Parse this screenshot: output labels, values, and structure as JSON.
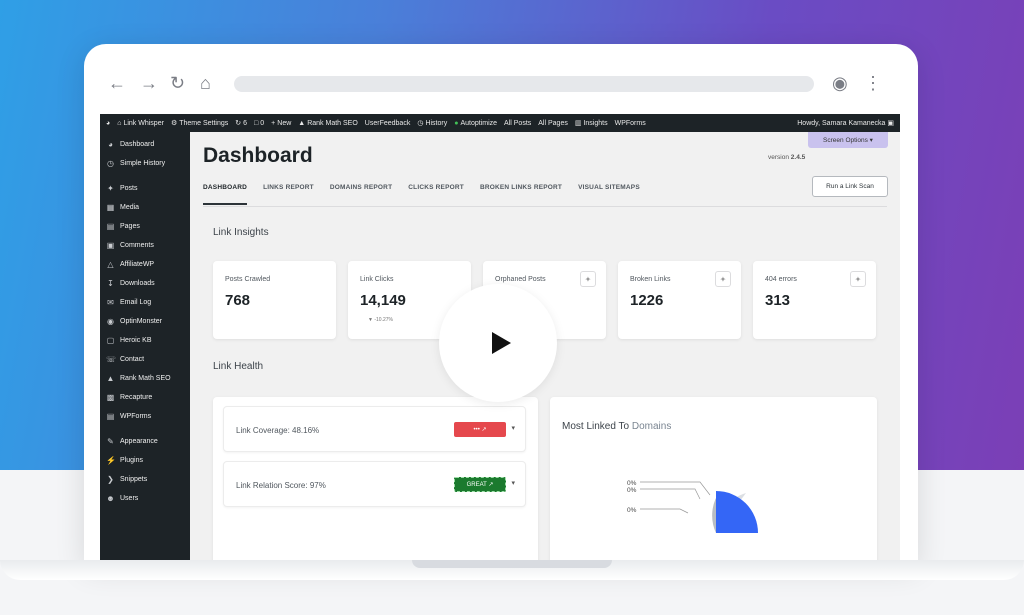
{
  "colors": {
    "gradient_start": "#2f9fe6",
    "gradient_end": "#7b3fb6",
    "wp_dark": "#1d2327",
    "badge_red": "#e5484d",
    "badge_green": "#1b7a2e",
    "chart_blue": "#3466f6"
  },
  "browser": {
    "icons": [
      "back-arrow-icon",
      "forward-arrow-icon",
      "reload-icon",
      "home-icon",
      "extension-icon",
      "kebab-menu-icon"
    ]
  },
  "topbar": {
    "items": [
      "Link Whisper",
      "Theme Settings",
      "6",
      "0",
      "New",
      "Rank Math SEO",
      "UserFeedback",
      "History",
      "Autoptimize",
      "All Posts",
      "All Pages",
      "Insights",
      "WPForms"
    ],
    "howdy": "Howdy, Samara Kamanecka"
  },
  "sidebar": {
    "items": [
      {
        "label": "Dashboard",
        "icon": "gauge-icon"
      },
      {
        "label": "Simple History",
        "icon": "history-icon"
      },
      {
        "label": "Posts",
        "icon": "pin-icon"
      },
      {
        "label": "Media",
        "icon": "media-icon"
      },
      {
        "label": "Pages",
        "icon": "page-icon"
      },
      {
        "label": "Comments",
        "icon": "comment-icon"
      },
      {
        "label": "AffiliateWP",
        "icon": "affiliate-icon"
      },
      {
        "label": "Downloads",
        "icon": "download-icon"
      },
      {
        "label": "Email Log",
        "icon": "email-icon"
      },
      {
        "label": "OptinMonster",
        "icon": "monster-icon"
      },
      {
        "label": "Heroic KB",
        "icon": "kb-icon"
      },
      {
        "label": "Contact",
        "icon": "contact-icon"
      },
      {
        "label": "Rank Math SEO",
        "icon": "chart-icon"
      },
      {
        "label": "Recapture",
        "icon": "recapture-icon"
      },
      {
        "label": "WPForms",
        "icon": "forms-icon"
      },
      {
        "label": "Appearance",
        "icon": "brush-icon"
      },
      {
        "label": "Plugins",
        "icon": "plug-icon"
      },
      {
        "label": "Snippets",
        "icon": "code-icon"
      },
      {
        "label": "Users",
        "icon": "user-icon"
      }
    ]
  },
  "header": {
    "screen_options": "Screen Options",
    "title": "Dashboard",
    "version_label": "version",
    "version_number": "2.4.5",
    "run_scan": "Run a Link Scan"
  },
  "tabs": [
    "DASHBOARD",
    "LINKS REPORT",
    "DOMAINS REPORT",
    "CLICKS REPORT",
    "BROKEN LINKS REPORT",
    "VISUAL SITEMAPS"
  ],
  "insights": {
    "title": "Link Insights",
    "cards": [
      {
        "label": "Posts Crawled",
        "value": "768"
      },
      {
        "label": "Link Clicks",
        "value": "14,149",
        "sub": "▼ -10.27%"
      },
      {
        "label": "Orphaned Posts",
        "value": ""
      },
      {
        "label": "Broken Links",
        "value": "1226"
      },
      {
        "label": "404 errors",
        "value": "313"
      }
    ]
  },
  "health": {
    "title": "Link Health",
    "rows": [
      {
        "label": "Link Coverage: 48.16%",
        "badge": "••• ↗"
      },
      {
        "label": "Link Relation Score: 97%",
        "badge": "GREAT ↗"
      }
    ]
  },
  "domains": {
    "title_a": "Most Linked To",
    "title_b": "Domains",
    "pie_labels": [
      "0%",
      "0%",
      "0%"
    ]
  }
}
